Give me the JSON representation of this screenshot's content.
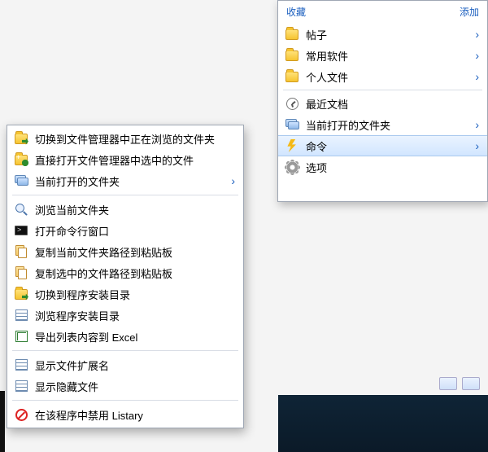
{
  "favorites": {
    "header_left": "收藏",
    "header_right": "添加",
    "items": [
      {
        "label": "帖子",
        "icon": "folder",
        "submenu": true
      },
      {
        "label": "常用软件",
        "icon": "folder",
        "submenu": true
      },
      {
        "label": "个人文件",
        "icon": "folder",
        "submenu": true
      }
    ],
    "section2": [
      {
        "label": "最近文档",
        "icon": "clock",
        "submenu": false
      },
      {
        "label": "当前打开的文件夹",
        "icon": "stack",
        "submenu": true
      },
      {
        "label": "命令",
        "icon": "bolt",
        "submenu": true,
        "selected": true
      },
      {
        "label": "选项",
        "icon": "gear",
        "submenu": false
      }
    ]
  },
  "contextMenu": {
    "group1": [
      {
        "label": "切换到文件管理器中正在浏览的文件夹",
        "icon": "folder-go"
      },
      {
        "label": "直接打开文件管理器中选中的文件",
        "icon": "folder-plus"
      },
      {
        "label": "当前打开的文件夹",
        "icon": "stack",
        "submenu": true
      }
    ],
    "group2": [
      {
        "label": "浏览当前文件夹",
        "icon": "mag"
      },
      {
        "label": "打开命令行窗口",
        "icon": "term"
      },
      {
        "label": "复制当前文件夹路径到粘贴板",
        "icon": "copy"
      },
      {
        "label": "复制选中的文件路径到粘贴板",
        "icon": "copy"
      },
      {
        "label": "切换到程序安装目录",
        "icon": "folder-go"
      },
      {
        "label": "浏览程序安装目录",
        "icon": "list"
      },
      {
        "label": "导出列表内容到 Excel",
        "icon": "xl"
      }
    ],
    "group3": [
      {
        "label": "显示文件扩展名",
        "icon": "list"
      },
      {
        "label": "显示隐藏文件",
        "icon": "list"
      }
    ],
    "group4": [
      {
        "label": "在该程序中禁用 Listary",
        "icon": "no"
      }
    ]
  }
}
